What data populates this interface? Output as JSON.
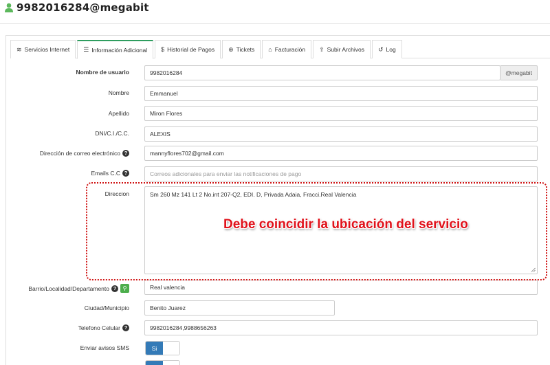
{
  "header": {
    "title": "9982016284@megabit",
    "icon": "user-icon",
    "accent": "#5cb85c"
  },
  "tabs": [
    {
      "label": "Servicios Internet",
      "icon": "wifi-icon",
      "glyph": "≋"
    },
    {
      "label": "Información Adicional",
      "icon": "list-icon",
      "glyph": "☰"
    },
    {
      "label": "Historial de Pagos",
      "icon": "dollar-icon",
      "glyph": "$"
    },
    {
      "label": "Tickets",
      "icon": "lifebuoy-icon",
      "glyph": "⊕"
    },
    {
      "label": "Facturación",
      "icon": "bank-icon",
      "glyph": "⌂"
    },
    {
      "label": "Subir Archivos",
      "icon": "upload-icon",
      "glyph": "⇪"
    },
    {
      "label": "Log",
      "icon": "history-icon",
      "glyph": "↺"
    }
  ],
  "form": {
    "username": {
      "label": "Nombre de usuario",
      "value": "9982016284",
      "addon": "@megabit"
    },
    "nombre": {
      "label": "Nombre",
      "value": "Emmanuel"
    },
    "apellido": {
      "label": "Apellido",
      "value": "Miron Flores"
    },
    "dni": {
      "label": "DNI/C.I./C.C.",
      "value": "ALEXIS"
    },
    "email": {
      "label": "Dirección de correo electrónico",
      "value": "mannyflores702@gmail.com"
    },
    "emails_cc": {
      "label": "Emails C.C",
      "placeholder": "Correos adicionales para enviar las notificaciones de pago"
    },
    "direccion": {
      "label": "Direccion",
      "value": "Sm 260 Mz 141 Lt 2 No.int 207-Q2, EDI. D, Privada Adaia, Fracci.Real Valencia"
    },
    "barrio": {
      "label": "Barrio/Localidad/Departamento",
      "value": "Real valencia"
    },
    "ciudad": {
      "label": "Ciudad/Municipio",
      "value": "Benito Juarez"
    },
    "telefono": {
      "label": "Telefono Celular",
      "value": "9982016284,9988656263"
    },
    "sms": {
      "label": "Enviar avisos SMS",
      "toggle_on": "Si"
    }
  },
  "annotation": {
    "text": "Debe coincidir la ubicación del servicio",
    "color": "#e0121b"
  }
}
